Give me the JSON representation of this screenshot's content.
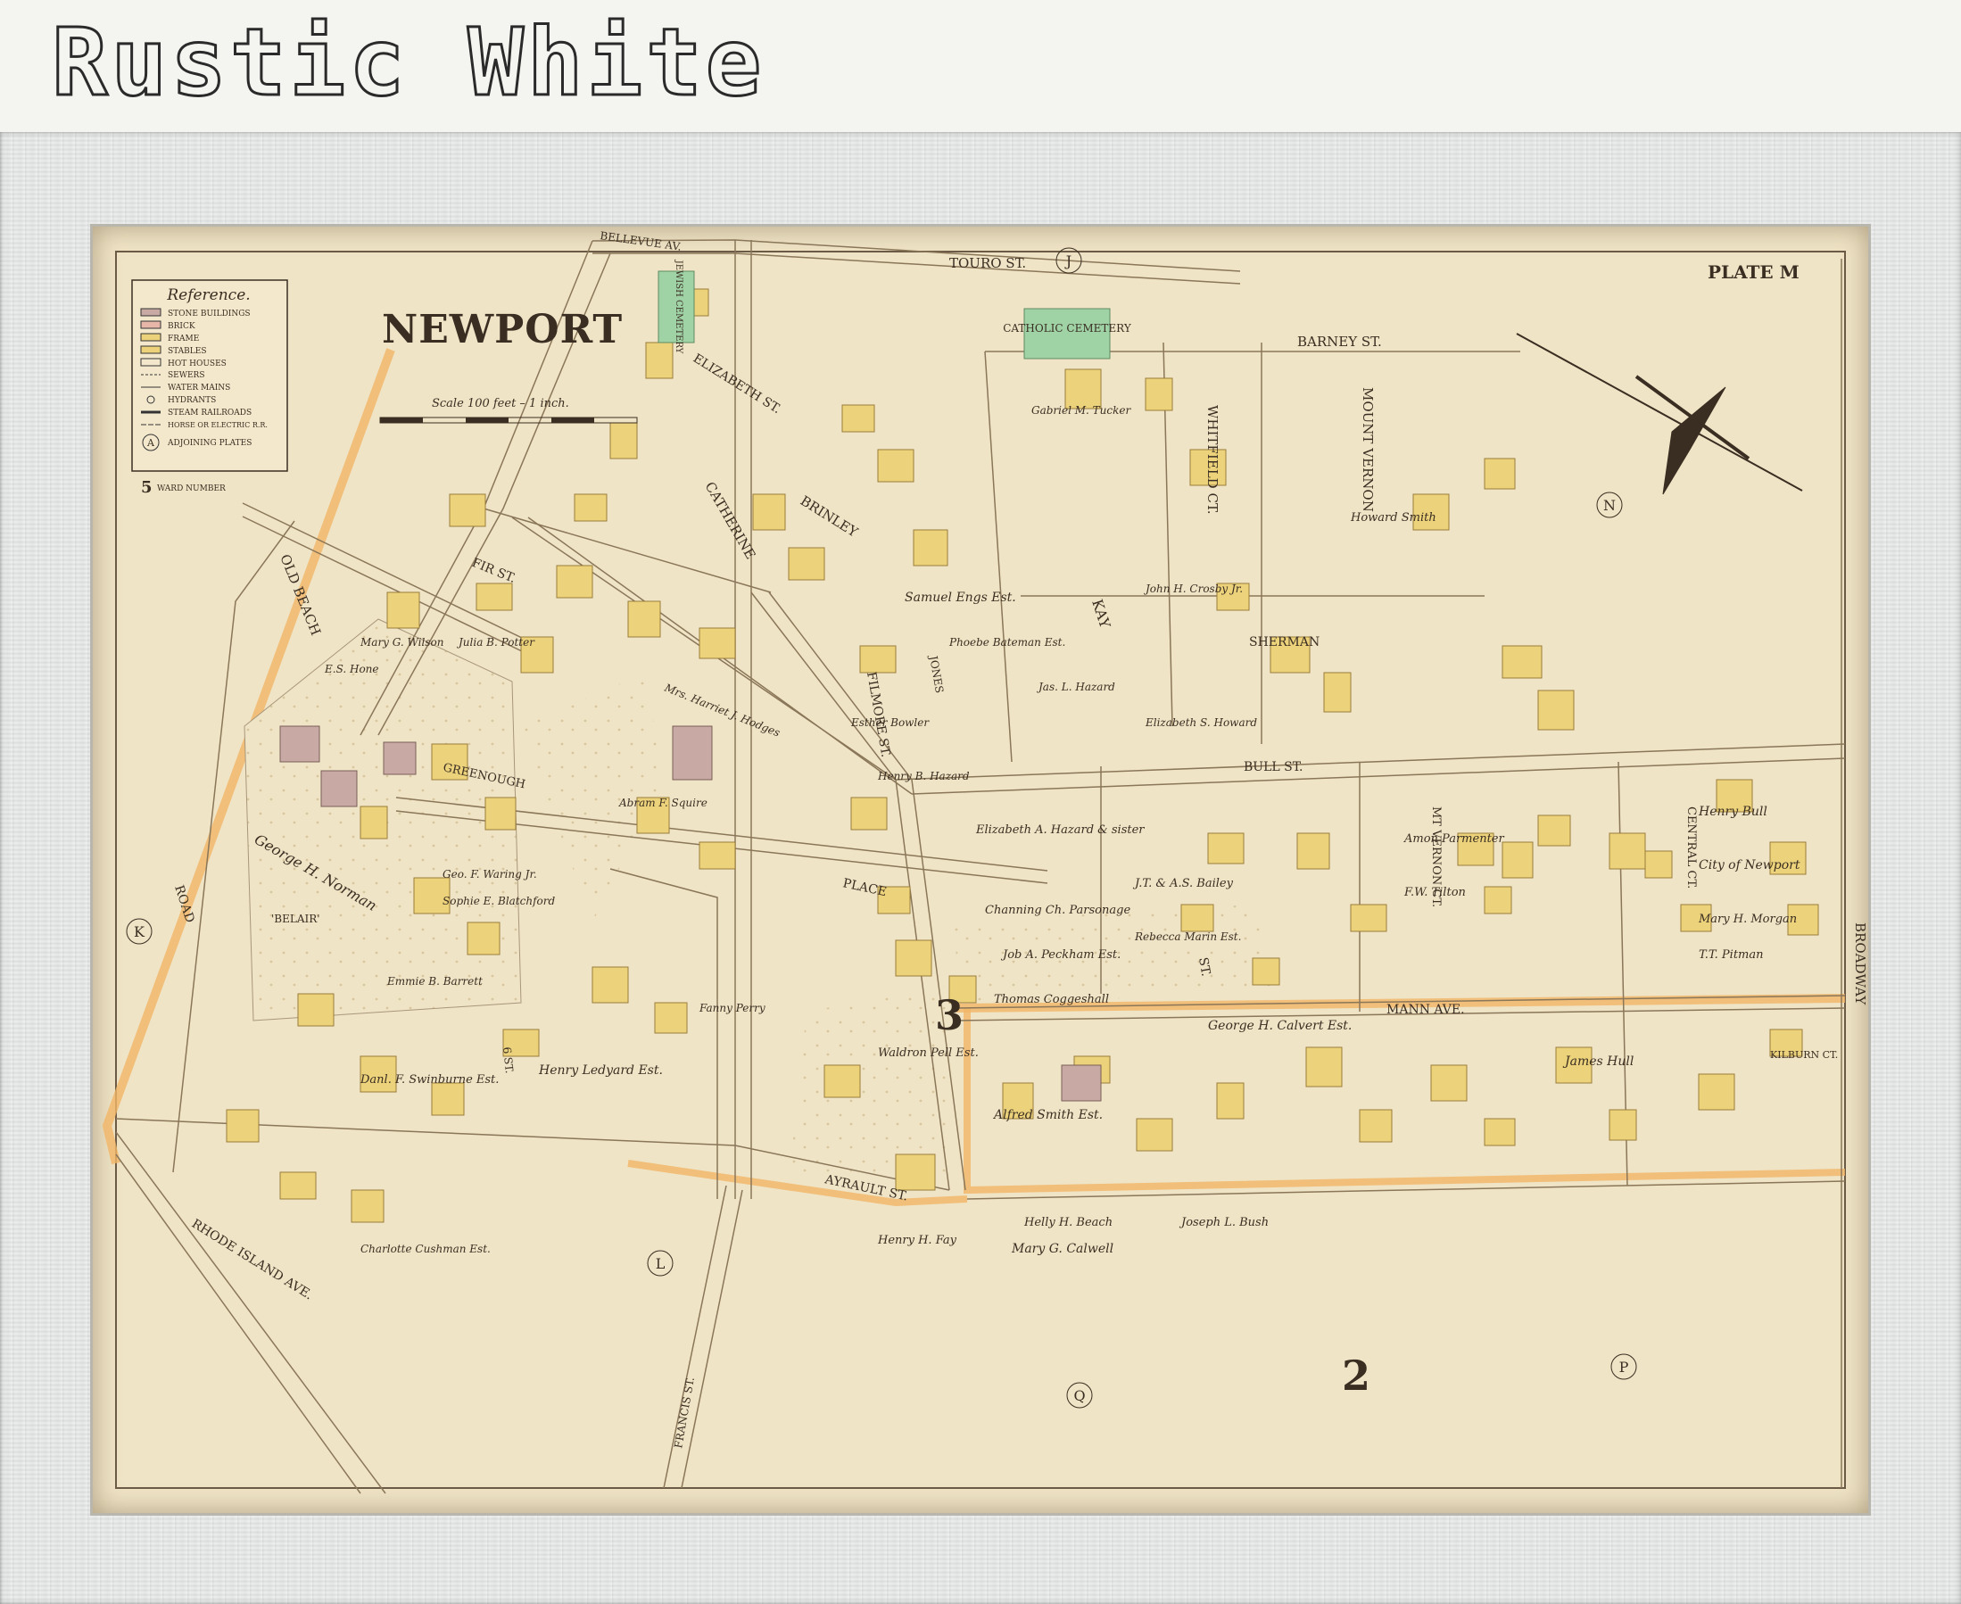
{
  "banner": {
    "title": "Rustic White"
  },
  "map": {
    "title": "NEWPORT",
    "plate": "PLATE M",
    "scale": "Scale 100 feet – 1 inch.",
    "reference": {
      "heading": "Reference.",
      "items": [
        "STONE BUILDINGS",
        "BRICK",
        "FRAME",
        "STABLES",
        "HOT HOUSES",
        "SEWERS",
        "WATER MAINS",
        "HYDRANTS",
        "STEAM RAILROADS",
        "HORSE OR ELECTRIC R.R.",
        "ADJOINING PLATES",
        "WARD NUMBER"
      ],
      "plate_letter": "A",
      "ward_number": "5"
    },
    "colors": {
      "paper": "#f0e4c6",
      "frame_building": "#ecd37b",
      "stone_building": "#c9a9a3",
      "cemetery": "#9fd3a6",
      "boundary": "#f1b567"
    },
    "plate_letters": [
      "J",
      "K",
      "L",
      "N",
      "P",
      "Q"
    ],
    "ward_numbers": [
      "3",
      "2"
    ],
    "streets": {
      "bellevue": "BELLEVUE AV.",
      "touro": "TOURO ST.",
      "elizabeth": "ELIZABETH ST.",
      "barney": "BARNEY ST.",
      "whitfield": "WHITFIELD CT.",
      "mount_vernon": "MOUNT VERNON",
      "kay": "KAY",
      "kay_st": "ST.",
      "catherine": "CATHERINE",
      "brinley": "BRINLEY",
      "fir": "FIR ST.",
      "old_beach": "OLD BEACH",
      "road": "ROAD",
      "greenough": "GREENOUGH",
      "place": "PLACE",
      "sherman": "SHERMAN",
      "filmore": "FILMORE ST.",
      "jones": "JONES",
      "bull": "BULL ST.",
      "mt_vernon_ct": "MT VERNON CT.",
      "central_ct": "CENTRAL CT.",
      "broadway": "BROADWAY",
      "mann_ave": "MANN AVE.",
      "kilburn_ct": "KILBURN CT.",
      "ayrault": "AYRAULT ST.",
      "francis": "FRANCIS ST.",
      "rhode_island": "RHODE ISLAND AVE.",
      "sixth": "6 ST."
    },
    "landmarks": {
      "jewish_cemetery": "JEWISH CEMETERY",
      "catholic_cemetery": "CATHOLIC CEMETERY",
      "belair": "'BELAIR'"
    },
    "owners": [
      "George H. Norman",
      "Henry Ledyard Est.",
      "Waldron Pell Est.",
      "Alfred Smith Est.",
      "Mary G. Calwell",
      "George H. Calvert Est.",
      "Henry Bull",
      "City of Newport",
      "Mary H. Morgan",
      "T.T. Pitman",
      "Howard Smith",
      "Samuel Engs Est.",
      "Elizabeth A. Hazard & sister",
      "Channing Ch. Parsonage",
      "Job A. Peckham Est.",
      "Thomas Coggeshall",
      "Helly H. Beach",
      "Joseph L. Bush",
      "James Hull",
      "Henry H. Fay",
      "Danl. F. Swinburne Est.",
      "Charlotte Cushman Est.",
      "Julia B. Potter",
      "Gabriel M. Tucker",
      "J.T. & A.S. Bailey",
      "Rebecca Marin Est.",
      "Amon Parmenter",
      "F.W. Tilton",
      "Emmie B. Barrett",
      "Fanny Perry",
      "Esther Bowler",
      "Elizabeth S. Howard",
      "John H. Crosby Jr.",
      "Jas. L. Hazard",
      "Phoebe Bateman Est.",
      "Henry B. Hazard",
      "Abram F. Squire",
      "Mrs. Harriet J. Hodges",
      "Sophie E. Blatchford",
      "Geo. F. Waring Jr.",
      "E.S. Hone",
      "Mary G. Wilson"
    ]
  }
}
